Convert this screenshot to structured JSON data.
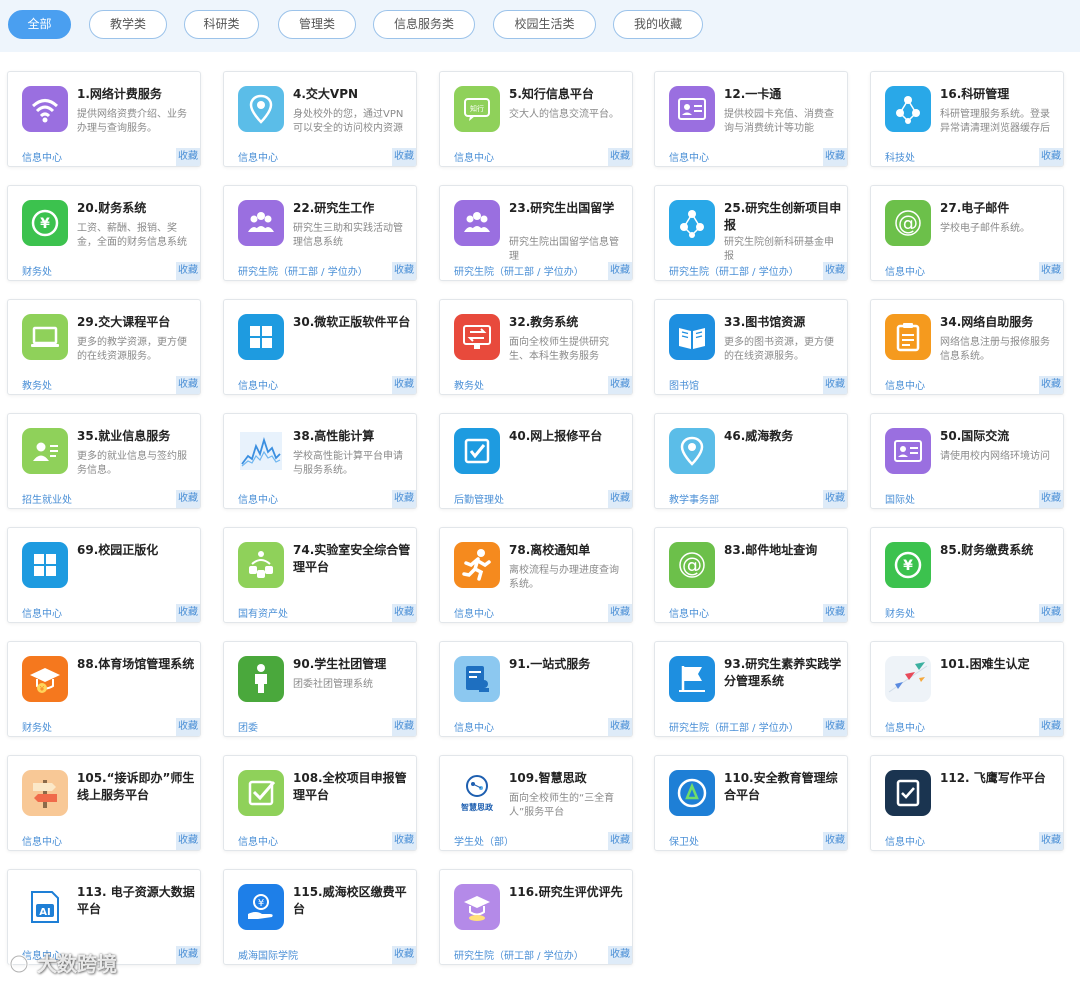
{
  "filters": [
    "全部",
    "教学类",
    "科研类",
    "管理类",
    "信息服务类",
    "校园生活类",
    "我的收藏"
  ],
  "fav_label": "收藏",
  "watermark": "大数跨境",
  "cards": [
    {
      "title": "1.网络计费服务",
      "desc": "提供网络资费介绍、业务办理与查询服务。",
      "dept": "信息中心",
      "icon": "wifi-icon",
      "color": "#9a6fe0"
    },
    {
      "title": "4.交大VPN",
      "desc": "身处校外的您，通过VPN可以安全的访问校内资源",
      "dept": "信息中心",
      "icon": "location-pin-icon",
      "color": "#5bbde8"
    },
    {
      "title": "5.知行信息平台",
      "desc": "交大人的信息交流平台。",
      "dept": "信息中心",
      "icon": "chat-bubble-icon",
      "color": "#8fd15a"
    },
    {
      "title": "12.一卡通",
      "desc": "提供校园卡充值、消费查询与消费统计等功能",
      "dept": "信息中心",
      "icon": "id-card-icon",
      "color": "#9a6fe0"
    },
    {
      "title": "16.科研管理",
      "desc": "科研管理服务系统。登录异常请清理浏览器缓存后再试",
      "dept": "科技处",
      "icon": "molecule-icon",
      "color": "#29a8e8"
    },
    {
      "title": "20.财务系统",
      "desc": "工资、薪酬、报销、奖金，全面的财务信息系统",
      "dept": "财务处",
      "icon": "yuan-coin-icon",
      "color": "#3cc24e"
    },
    {
      "title": "22.研究生工作",
      "desc": "研究生三助和实践活动管理信息系统",
      "dept": "研究生院（研工部 / 学位办）",
      "icon": "people-group-icon",
      "color": "#9a6fe0"
    },
    {
      "title": "23.研究生出国留学",
      "desc": "研究生院出国留学信息管理",
      "dept": "研究生院（研工部 / 学位办）",
      "icon": "people-group-icon",
      "color": "#9a6fe0"
    },
    {
      "title": "25.研究生创新项目申报",
      "desc": "研究生院创新科研基金申报",
      "dept": "研究生院（研工部 / 学位办）",
      "icon": "molecule-icon",
      "color": "#29a8e8"
    },
    {
      "title": "27.电子邮件",
      "desc": "学校电子邮件系统。",
      "dept": "信息中心",
      "icon": "at-sign-icon",
      "color": "#6cc04a"
    },
    {
      "title": "29.交大课程平台",
      "desc": "更多的教学资源，更方便的在线资源服务。",
      "dept": "教务处",
      "icon": "laptop-icon",
      "color": "#8fd15a"
    },
    {
      "title": "30.微软正版软件平台",
      "desc": "",
      "dept": "信息中心",
      "icon": "windows-grid-icon",
      "color": "#1e9be0"
    },
    {
      "title": "32.教务系统",
      "desc": "面向全校师生提供研究生、本科生教务服务",
      "dept": "教务处",
      "icon": "monitor-exchange-icon",
      "color": "#e84a3c"
    },
    {
      "title": "33.图书馆资源",
      "desc": "更多的图书资源，更方便的在线资源服务。",
      "dept": "图书馆",
      "icon": "open-book-icon",
      "color": "#1e8fe0"
    },
    {
      "title": "34.网络自助服务",
      "desc": "网络信息注册与报修服务信息系统。",
      "dept": "信息中心",
      "icon": "clipboard-icon",
      "color": "#f59a1e"
    },
    {
      "title": "35.就业信息服务",
      "desc": "更多的就业信息与签约服务信息。",
      "dept": "招生就业处",
      "icon": "person-card-icon",
      "color": "#8fd15a"
    },
    {
      "title": "38.高性能计算",
      "desc": "学校高性能计算平台申请与服务系统。",
      "dept": "信息中心",
      "icon": "line-chart-icon",
      "color": "#3b8fe0"
    },
    {
      "title": "40.网上报修平台",
      "desc": "",
      "dept": "后勤管理处",
      "icon": "checkbox-icon",
      "color": "#1e9be0"
    },
    {
      "title": "46.威海教务",
      "desc": "",
      "dept": "教学事务部",
      "icon": "location-pin-icon",
      "color": "#5bbde8"
    },
    {
      "title": "50.国际交流",
      "desc": "请使用校内网络环境访问",
      "dept": "国际处",
      "icon": "id-card-icon",
      "color": "#9a6fe0"
    },
    {
      "title": "69.校园正版化",
      "desc": "",
      "dept": "信息中心",
      "icon": "windows-grid-icon",
      "color": "#1e9be0"
    },
    {
      "title": "74.实验室安全综合管理平台",
      "desc": "",
      "dept": "国有资产处",
      "icon": "network-nodes-icon",
      "color": "#8fd15a"
    },
    {
      "title": "78.离校通知单",
      "desc": "离校流程与办理进度查询系统。",
      "dept": "信息中心",
      "icon": "running-person-icon",
      "color": "#f58a1e"
    },
    {
      "title": "83.邮件地址查询",
      "desc": "",
      "dept": "信息中心",
      "icon": "at-sign-icon",
      "color": "#6cc04a"
    },
    {
      "title": "85.财务缴费系统",
      "desc": "",
      "dept": "财务处",
      "icon": "yuan-coin-icon",
      "color": "#3cc24e"
    },
    {
      "title": "88.体育场馆管理系统",
      "desc": "",
      "dept": "财务处",
      "icon": "graduation-cap-icon",
      "color": "#f5781e"
    },
    {
      "title": "90.学生社团管理",
      "desc": "团委社团管理系统",
      "dept": "团委",
      "icon": "person-icon",
      "color": "#4aa83c"
    },
    {
      "title": "91.一站式服务",
      "desc": "",
      "dept": "信息中心",
      "icon": "document-stamp-icon",
      "color": "#8cc8f0"
    },
    {
      "title": "93.研究生素养实践学分管理系统",
      "desc": "",
      "dept": "研究生院（研工部 / 学位办）",
      "icon": "flag-icon",
      "color": "#1e8fe0"
    },
    {
      "title": "101.困难生认定",
      "desc": "",
      "dept": "信息中心",
      "icon": "paper-planes-icon",
      "color": "#eef3f8"
    },
    {
      "title": "105.“接诉即办”师生线上服务平台",
      "desc": "",
      "dept": "信息中心",
      "icon": "signpost-icon",
      "color": "#f8c896"
    },
    {
      "title": "108.全校项目申报管理平台",
      "desc": "",
      "dept": "信息中心",
      "icon": "check-square-icon",
      "color": "#8fd15a"
    },
    {
      "title": "109.智慧思政",
      "desc": "面向全校师生的“三全育人”服务平台",
      "dept": "学生处（部）",
      "icon": "ai-head-icon",
      "color": "#ffffff"
    },
    {
      "title": "110.安全教育管理综合平台",
      "desc": "",
      "dept": "保卫处",
      "icon": "shield-circle-icon",
      "color": "#1e7fd6"
    },
    {
      "title": "112. 飞鹰写作平台",
      "desc": "",
      "dept": "信息中心",
      "icon": "writing-check-icon",
      "color": "#1a3450"
    },
    {
      "title": "113. 电子资源大数据平台",
      "desc": "",
      "dept": "信息中心",
      "icon": "ai-document-icon",
      "color": "#ffffff"
    },
    {
      "title": "115.威海校区缴费平台",
      "desc": "",
      "dept": "威海国际学院",
      "icon": "payment-hand-icon",
      "color": "#1e7fe8"
    },
    {
      "title": "116.研究生评优评先",
      "desc": "",
      "dept": "研究生院（研工部 / 学位办）",
      "icon": "graduate-award-icon",
      "color": "#b48ae8"
    }
  ]
}
